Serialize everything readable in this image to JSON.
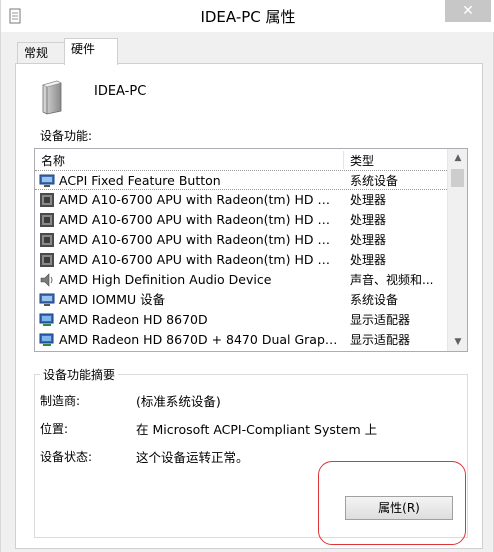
{
  "window": {
    "title": "IDEA-PC 属性",
    "close_glyph": "✕"
  },
  "tabs": [
    {
      "label": "常规",
      "active": false
    },
    {
      "label": "硬件",
      "active": true
    }
  ],
  "device": {
    "name": "IDEA-PC"
  },
  "devices_section": {
    "label": "设备功能:",
    "columns": {
      "name": "名称",
      "type": "类型"
    },
    "rows": [
      {
        "name": "ACPI Fixed Feature Button",
        "type": "系统设备",
        "icon": "system-device-icon"
      },
      {
        "name": "AMD A10-6700 APU with Radeon(tm) HD Gr...",
        "type": "处理器",
        "icon": "processor-icon"
      },
      {
        "name": "AMD A10-6700 APU with Radeon(tm) HD Gr...",
        "type": "处理器",
        "icon": "processor-icon"
      },
      {
        "name": "AMD A10-6700 APU with Radeon(tm) HD Gr...",
        "type": "处理器",
        "icon": "processor-icon"
      },
      {
        "name": "AMD A10-6700 APU with Radeon(tm) HD Gr...",
        "type": "处理器",
        "icon": "processor-icon"
      },
      {
        "name": "AMD High Definition Audio Device",
        "type": "声音、视频和...",
        "icon": "speaker-icon"
      },
      {
        "name": "AMD IOMMU 设备",
        "type": "系统设备",
        "icon": "system-device-icon"
      },
      {
        "name": "AMD Radeon HD 8670D",
        "type": "显示适配器",
        "icon": "display-adapter-icon"
      },
      {
        "name": "AMD Radeon HD 8670D + 8470 Dual Graphi...",
        "type": "显示适配器",
        "icon": "display-adapter-icon"
      }
    ]
  },
  "summary": {
    "title": "设备功能摘要",
    "manufacturer_label": "制造商:",
    "manufacturer_value": "(标准系统设备)",
    "location_label": "位置:",
    "location_value": "在 Microsoft ACPI-Compliant System 上",
    "status_label": "设备状态:",
    "status_value": "这个设备运转正常。",
    "properties_button": "属性(R)"
  },
  "colors": {
    "highlight": "#e0333a"
  }
}
